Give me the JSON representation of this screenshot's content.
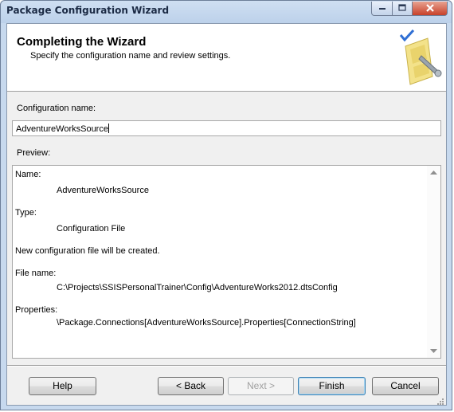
{
  "window": {
    "title": "Package Configuration Wizard"
  },
  "caption_buttons": {
    "minimize_icon": "minimize-icon",
    "maximize_icon": "maximize-icon",
    "close_icon": "close-icon"
  },
  "header": {
    "title": "Completing the Wizard",
    "subtitle": "Specify the configuration name and review settings."
  },
  "form": {
    "config_name_label": "Configuration name:",
    "config_name_value": "AdventureWorksSource",
    "preview_label": "Preview:"
  },
  "preview": {
    "name_label": "Name:",
    "name_value": "AdventureWorksSource",
    "type_label": "Type:",
    "type_value": "Configuration File",
    "new_file_note": "New configuration file will be created.",
    "file_name_label": "File name:",
    "file_name_value": "C:\\Projects\\SSISPersonalTrainer\\Config\\AdventureWorks2012.dtsConfig",
    "properties_label": "Properties:",
    "properties_value": "\\Package.Connections[AdventureWorksSource].Properties[ConnectionString]"
  },
  "buttons": {
    "help": "Help",
    "back": "< Back",
    "next": "Next >",
    "finish": "Finish",
    "cancel": "Cancel"
  },
  "colors": {
    "title_bar": "#bcd1ea",
    "close_button": "#c7412a",
    "client_background": "#f0f0f0",
    "default_button_border": "#3c7fb1"
  }
}
